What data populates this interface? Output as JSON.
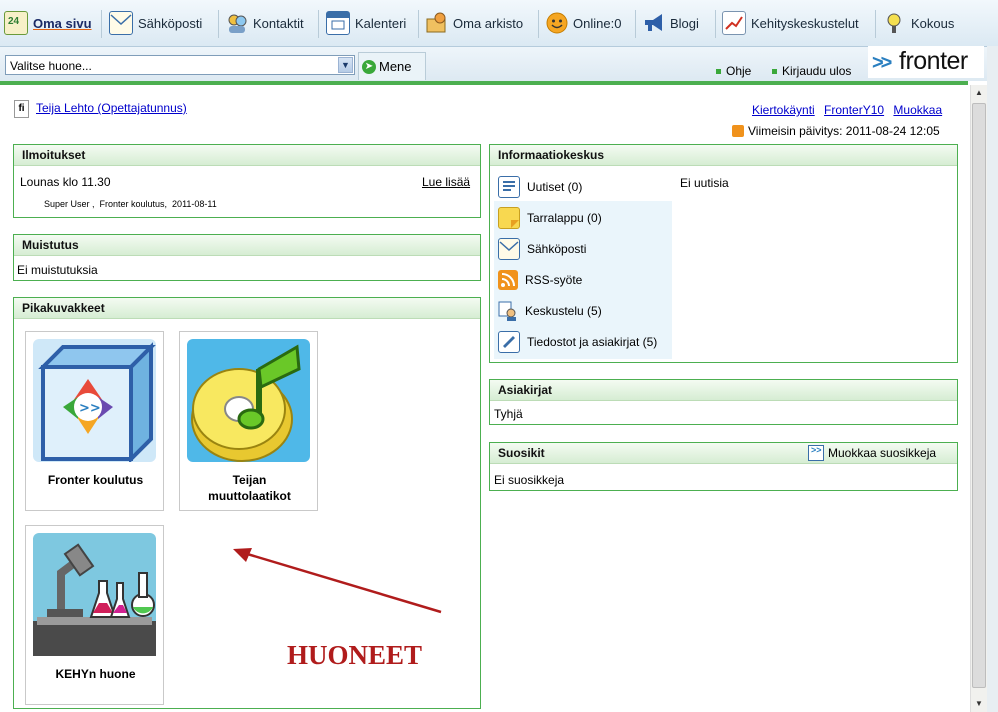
{
  "nav": {
    "items": [
      {
        "label": "Oma sivu",
        "icon": "calendar-24-icon"
      },
      {
        "label": "Sähköposti",
        "icon": "mail-icon"
      },
      {
        "label": "Kontaktit",
        "icon": "contacts-icon"
      },
      {
        "label": "Kalenteri",
        "icon": "calendar-icon"
      },
      {
        "label": "Oma arkisto",
        "icon": "archive-icon"
      },
      {
        "label": "Online:0",
        "icon": "smiley-icon"
      },
      {
        "label": "Blogi",
        "icon": "megaphone-icon"
      },
      {
        "label": "Kehityskeskustelut",
        "icon": "chart-icon"
      },
      {
        "label": "Kokous",
        "icon": "meeting-icon"
      }
    ],
    "calendar_day": "24"
  },
  "room_select": {
    "value": "Valitse huone...",
    "go_label": "Mene"
  },
  "top_links": {
    "help": "Ohje",
    "logout": "Kirjaudu ulos"
  },
  "logo": {
    "arrows": ">>",
    "word": "fronter"
  },
  "user": {
    "lang": "fi",
    "name": "Teija Lehto (Opettajatunnus)"
  },
  "header_links": {
    "tour": "Kiertokäynti",
    "fronter10": "FronterY10",
    "edit": "Muokkaa"
  },
  "last_update": "Viimeisin päivitys: 2011-08-24 12:05",
  "ilmoitukset": {
    "title": "Ilmoitukset",
    "item_title": "Lounas klo 11.30",
    "read_more": "Lue lisää",
    "meta": "Super User ,  Fronter koulutus,  2011-08-11"
  },
  "muistutus": {
    "title": "Muistutus",
    "body": "Ei muistutuksia"
  },
  "pikakuvakkeet": {
    "title": "Pikakuvakkeet",
    "items": [
      {
        "label": "Fronter koulutus",
        "icon": "fronter-box-icon"
      },
      {
        "label_line1": "Teijan",
        "label_line2": "muuttolaatikot",
        "icon": "music-cd-icon"
      },
      {
        "label": "KEHYn huone",
        "icon": "lab-microscope-icon"
      }
    ]
  },
  "informaatiokeskus": {
    "title": "Informaatiokeskus",
    "items": [
      {
        "label": "Uutiset (0)",
        "icon": "news-icon"
      },
      {
        "label": "Tarralappu (0)",
        "icon": "sticky-note-icon"
      },
      {
        "label": "Sähköposti",
        "icon": "mail-icon"
      },
      {
        "label": "RSS-syöte",
        "icon": "rss-icon"
      },
      {
        "label": "Keskustelu (5)",
        "icon": "discussion-icon"
      },
      {
        "label": "Tiedostot ja asiakirjat (5)",
        "icon": "documents-icon"
      }
    ],
    "detail": "Ei uutisia"
  },
  "asiakirjat": {
    "title": "Asiakirjat",
    "body": "Tyhjä"
  },
  "suosikit": {
    "title": "Suosikit",
    "edit_label": "Muokkaa suosikkeja",
    "body": "Ei suosikkeja"
  },
  "annotation": "HUONEET",
  "colors": {
    "accent_green": "#4caf50",
    "annotation_red": "#b01c1c",
    "link_blue": "#0000cc"
  }
}
